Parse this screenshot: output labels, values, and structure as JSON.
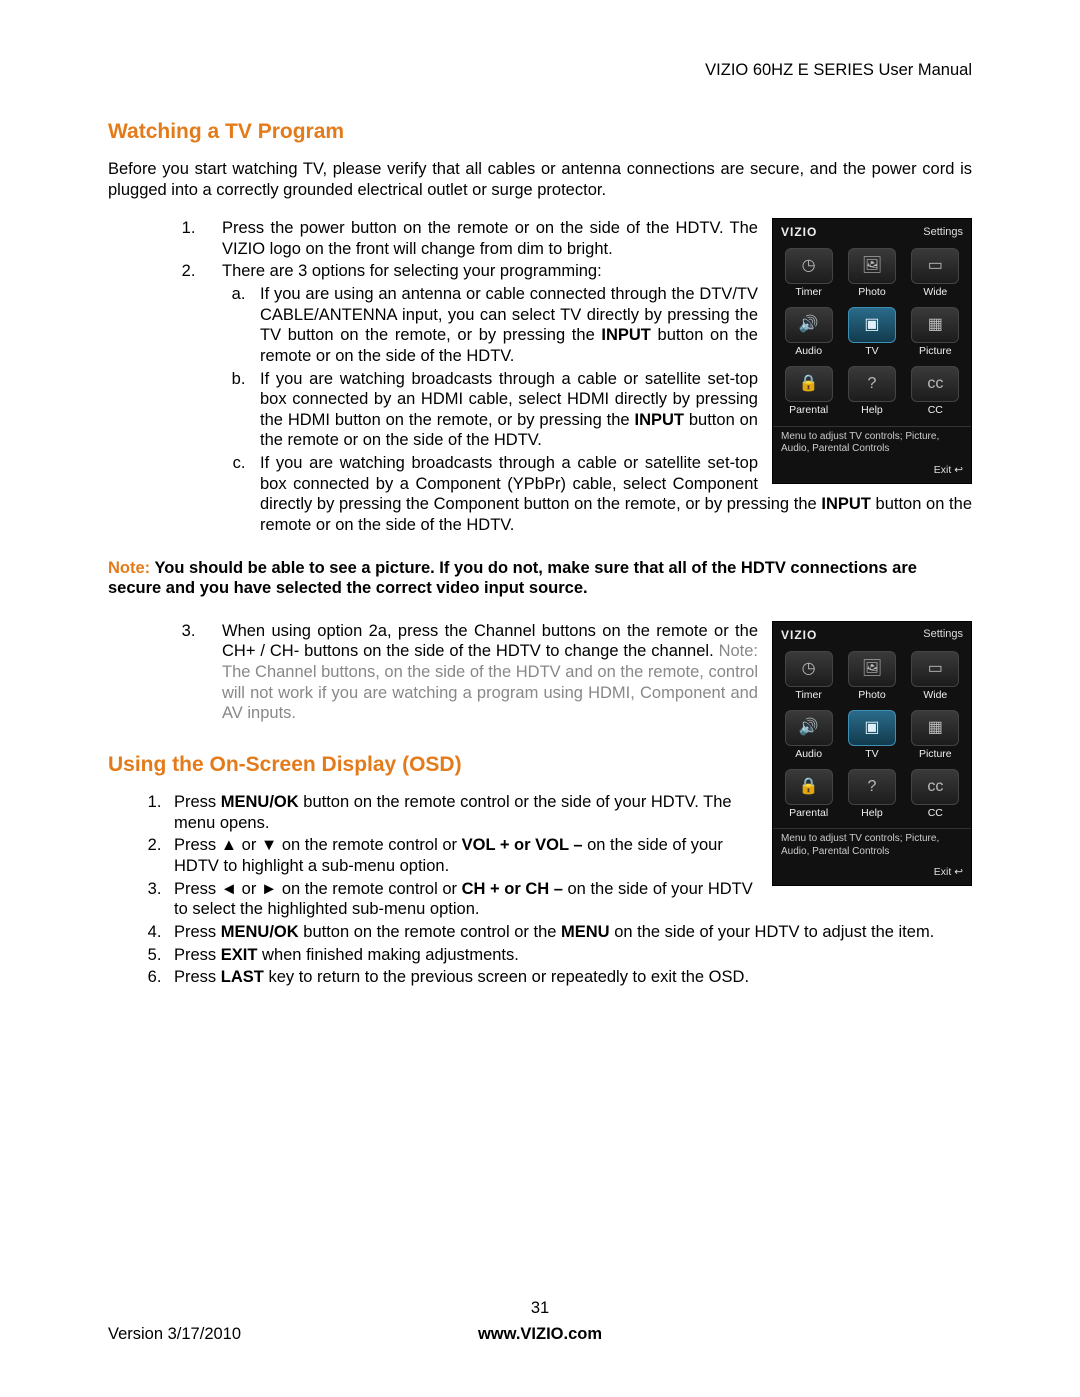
{
  "header": {
    "manual_title": "VIZIO 60HZ E SERIES User Manual"
  },
  "section1": {
    "heading": "Watching a TV Program",
    "intro": "Before you start watching TV, please verify that all cables or antenna connections are secure, and the power cord is plugged into a correctly grounded electrical outlet or surge protector.",
    "step1": "Press the power button on the remote or on the side of the HDTV.  The VIZIO logo on the front will change from dim to bright.",
    "step2_lead": "There are 3 options for selecting your programming:",
    "step2a_pre": "If you are using an antenna or cable connected through the DTV/TV CABLE/ANTENNA input, you can select TV directly by pressing the TV button on the remote, or by pressing the ",
    "step2a_post": " button on the remote or on the side of the HDTV.",
    "step2b_pre": "If you are watching broadcasts through a cable or satellite set-top box connected by an HDMI cable, select HDMI directly by pressing the HDMI button on the remote, or by pressing the ",
    "step2b_post": " button on the remote or on the side of the HDTV.",
    "step2c_pre": "If you are watching broadcasts through a cable or satellite set-top box connected by a Component (YPbPr) cable, select Component directly by pressing the Component button on the remote, or by pressing the ",
    "step2c_post": " button on the remote or on the side of the HDTV.",
    "input_word": "INPUT",
    "note_label": "Note: ",
    "note_body": "You should be able to see a picture.  If you do not, make sure that all of the HDTV connections are secure and you have selected the correct video input source.",
    "step3_black": "When using option 2a, press the Channel buttons on the remote or the CH+ / CH- buttons on the side of the HDTV to change the channel.  ",
    "step3_gray": "Note: The Channel buttons, on the side of the HDTV and on the remote, control will not work if you are watching a program using HDMI, Component and AV inputs."
  },
  "section2": {
    "heading": "Using the On-Screen Display (OSD)",
    "s1_a": "Press ",
    "s1_b": "MENU/OK",
    "s1_c": " button on the remote control or the side of your HDTV. The menu opens.",
    "s2_a": "Press ▲ or ▼ on the remote control or ",
    "s2_b": "VOL + or VOL –",
    "s2_c": " on the side of your HDTV to highlight a sub-menu option.",
    "s3_a": "Press ◄ or ► on the remote control or ",
    "s3_b": "CH + or CH –",
    "s3_c": " on the side of your HDTV to select the highlighted sub-menu option.",
    "s4_a": "Press ",
    "s4_b": "MENU/OK",
    "s4_c": " button on the remote control or the ",
    "s4_d": "MENU",
    "s4_e": " on the side of your HDTV to adjust the item.",
    "s5_a": "Press ",
    "s5_b": "EXIT",
    "s5_c": " when finished making adjustments.",
    "s6_a": "Press ",
    "s6_b": "LAST",
    "s6_c": " key to return to the previous screen or repeatedly to exit the OSD."
  },
  "osd": {
    "logo": "VIZIO",
    "header_right": "Settings",
    "tiles": {
      "timer": "Timer",
      "photo": "Photo",
      "wide": "Wide",
      "audio": "Audio",
      "tv": "TV",
      "picture": "Picture",
      "parental": "Parental",
      "help": "Help",
      "cc": "CC"
    },
    "desc": "Menu to adjust TV controls; Picture, Audio, Parental Controls",
    "exit": "Exit ↩"
  },
  "footer": {
    "page": "31",
    "version": "Version 3/17/2010",
    "site": "www.VIZIO.com"
  }
}
